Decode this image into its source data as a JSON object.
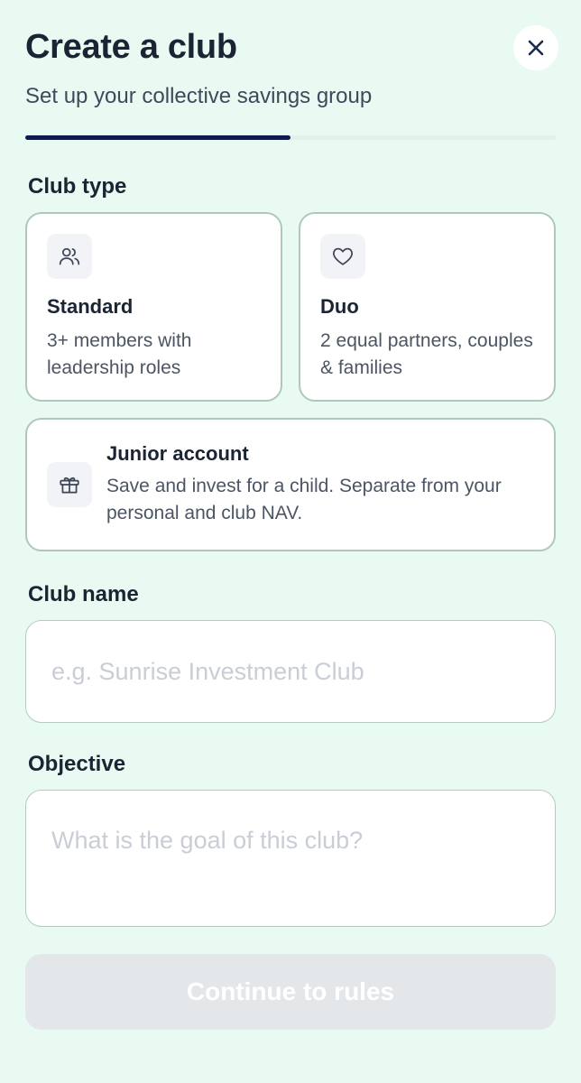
{
  "header": {
    "title": "Create a club",
    "subtitle": "Set up your collective savings group",
    "close_icon": "close-icon"
  },
  "progress": {
    "fraction": 0.5
  },
  "club_type": {
    "label": "Club type",
    "options": [
      {
        "icon": "users-icon",
        "title": "Standard",
        "description": "3+ members with leadership roles"
      },
      {
        "icon": "heart-icon",
        "title": "Duo",
        "description": "2 equal partners, couples & families"
      },
      {
        "icon": "gift-icon",
        "title": "Junior account",
        "description": "Save and invest for a child. Separate from your personal and club NAV."
      }
    ]
  },
  "club_name": {
    "label": "Club name",
    "value": "",
    "placeholder": "e.g. Sunrise Investment Club"
  },
  "objective": {
    "label": "Objective",
    "value": "",
    "placeholder": "What is the goal of this club?"
  },
  "continue_button": {
    "label": "Continue to rules",
    "enabled": false
  },
  "colors": {
    "background": "#e8faf2",
    "progress_fill": "#0f1b50",
    "card_border": "#aec9b9",
    "button_disabled": "#e4e7ea"
  }
}
